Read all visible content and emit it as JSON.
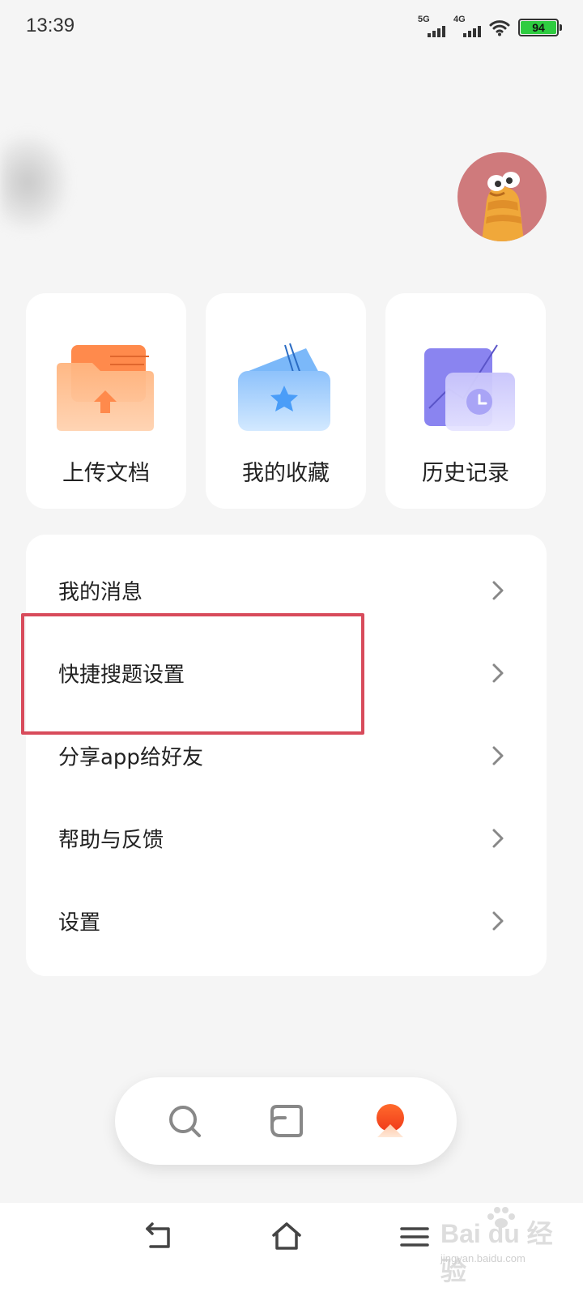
{
  "status_bar": {
    "time": "13:39",
    "network_1": "5G",
    "network_2": "4G",
    "battery": "94"
  },
  "quick_actions": [
    {
      "label": "上传文档",
      "icon": "upload-folder-icon",
      "color": "#ff8a4c"
    },
    {
      "label": "我的收藏",
      "icon": "favorites-star-icon",
      "color": "#4a9df8"
    },
    {
      "label": "历史记录",
      "icon": "history-clock-icon",
      "color": "#8a84f0"
    }
  ],
  "menu": {
    "items": [
      {
        "label": "我的消息"
      },
      {
        "label": "快捷搜题设置"
      },
      {
        "label": "分享app给好友"
      },
      {
        "label": "帮助与反馈"
      },
      {
        "label": "设置"
      }
    ]
  },
  "highlight_color": "#d84b5b",
  "tab_bar": {
    "items": [
      {
        "icon": "search-icon"
      },
      {
        "icon": "notebook-icon"
      },
      {
        "icon": "profile-sun-icon",
        "active": true
      }
    ]
  },
  "nav_bar": {
    "items": [
      {
        "icon": "back-icon"
      },
      {
        "icon": "home-icon"
      },
      {
        "icon": "menu-icon"
      }
    ]
  },
  "watermark": {
    "logo_text": "Bai du 经验",
    "url": "jingyan.baidu.com"
  }
}
